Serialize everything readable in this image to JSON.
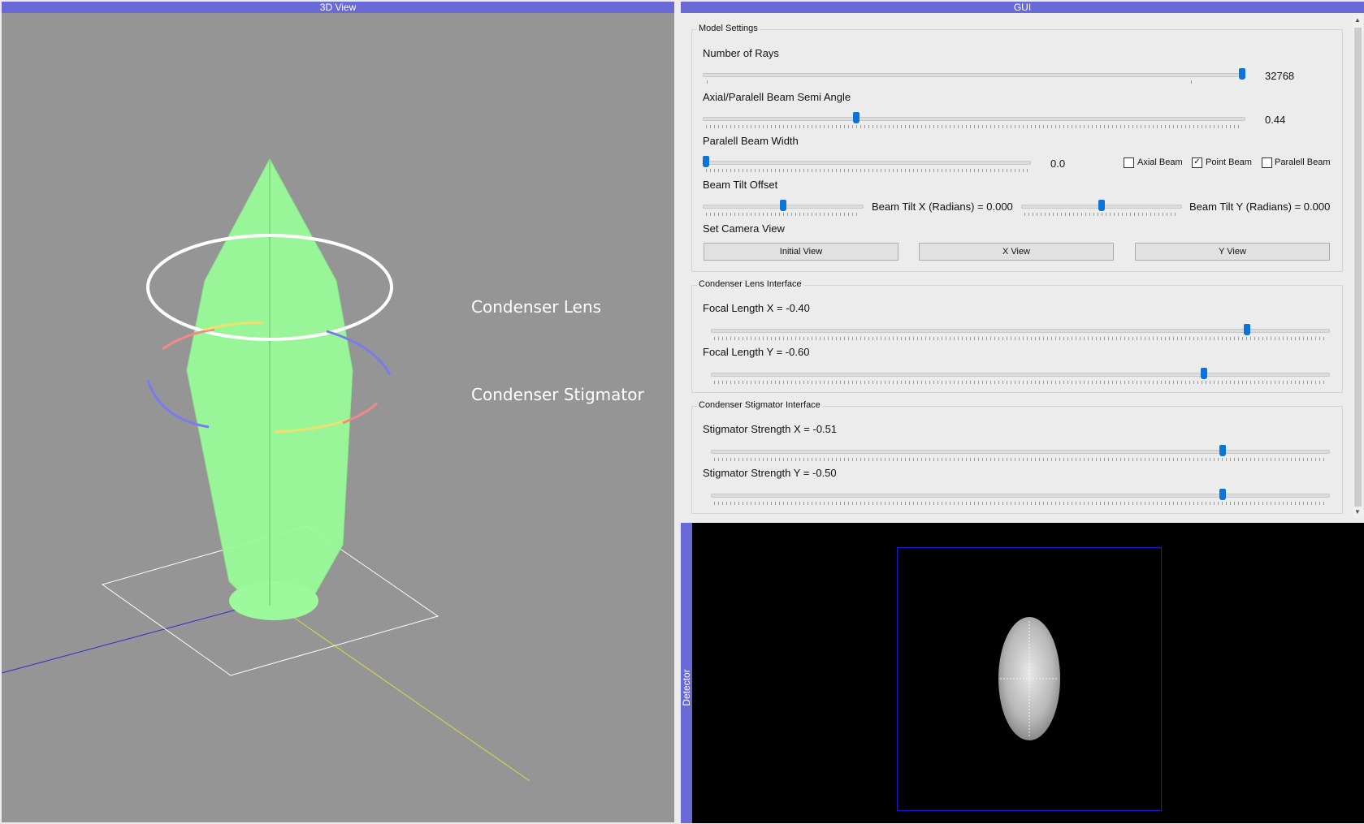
{
  "panels": {
    "view3d_title": "3D View",
    "gui_title": "GUI",
    "detector_title": "Detector"
  },
  "scene_labels": {
    "condenser_lens": "Condenser Lens",
    "condenser_stigmator": "Condenser Stigmator"
  },
  "model_settings": {
    "title": "Model Settings",
    "number_of_rays": {
      "label": "Number of Rays",
      "value": "32768",
      "level": 1.0
    },
    "semi_angle": {
      "label": "Axial/Paralell Beam Semi Angle",
      "value": "0.44",
      "level": 0.28
    },
    "beam_width": {
      "label": "Paralell Beam Width",
      "value": "0.0",
      "level": 0.0
    },
    "checkboxes": {
      "axial": {
        "label": "Axial Beam",
        "checked": false
      },
      "point": {
        "label": "Point Beam",
        "checked": true
      },
      "parallel": {
        "label": "Paralell Beam",
        "checked": false
      }
    },
    "beam_tilt": {
      "label": "Beam Tilt Offset",
      "x_label": "Beam Tilt X (Radians) = 0.000",
      "y_label": "Beam Tilt Y (Radians) = 0.000",
      "x_level": 0.5,
      "y_level": 0.5
    },
    "camera": {
      "label": "Set Camera View",
      "initial": "Initial View",
      "x_view": "X View",
      "y_view": "Y View"
    }
  },
  "condenser_lens_interface": {
    "title": "Condenser Lens Interface",
    "focal_x": {
      "label": "Focal Length X = -0.40",
      "level": 0.87
    },
    "focal_y": {
      "label": "Focal Length Y = -0.60",
      "level": 0.8
    }
  },
  "condenser_stigmator_interface": {
    "title": "Condenser Stigmator Interface",
    "strength_x": {
      "label": "Stigmator Strength X = -0.51",
      "level": 0.83
    },
    "strength_y": {
      "label": "Stigmator Strength Y = -0.50",
      "level": 0.83
    }
  },
  "colors": {
    "title_bar": "#6a6ad6",
    "slider_handle": "#0a74da",
    "beam": "#98fb98",
    "view_bg": "#959595"
  }
}
